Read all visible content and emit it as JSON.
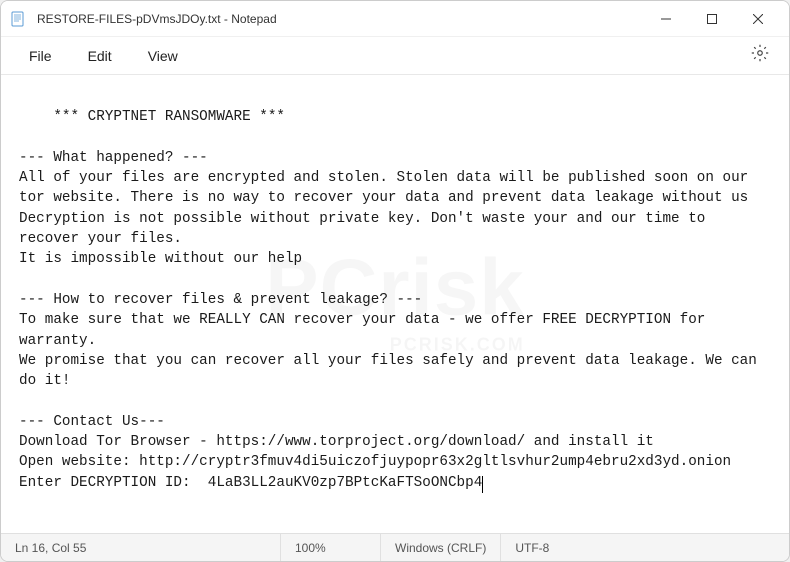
{
  "window": {
    "title": "RESTORE-FILES-pDVmsJDOy.txt - Notepad"
  },
  "menu": {
    "file": "File",
    "edit": "Edit",
    "view": "View"
  },
  "content": {
    "text": "*** CRYPTNET RANSOMWARE ***\n\n--- What happened? ---\nAll of your files are encrypted and stolen. Stolen data will be published soon on our tor website. There is no way to recover your data and prevent data leakage without us\nDecryption is not possible without private key. Don't waste your and our time to recover your files.\nIt is impossible without our help\n\n--- How to recover files & prevent leakage? ---\nTo make sure that we REALLY CAN recover your data - we offer FREE DECRYPTION for warranty.\nWe promise that you can recover all your files safely and prevent data leakage. We can do it!\n\n--- Contact Us---\nDownload Tor Browser - https://www.torproject.org/download/ and install it\nOpen website: http://cryptr3fmuv4di5uiczofjuypopr63x2gltlsvhur2ump4ebru2xd3yd.onion\nEnter DECRYPTION ID:  4LaB3LL2auKV0zp7BPtcKaFTSoONCbp4"
  },
  "status": {
    "position": "Ln 16, Col 55",
    "zoom": "100%",
    "line_ending": "Windows (CRLF)",
    "encoding": "UTF-8"
  },
  "watermark": {
    "main": "PCrisk",
    "sub": "PCRISK.COM"
  }
}
